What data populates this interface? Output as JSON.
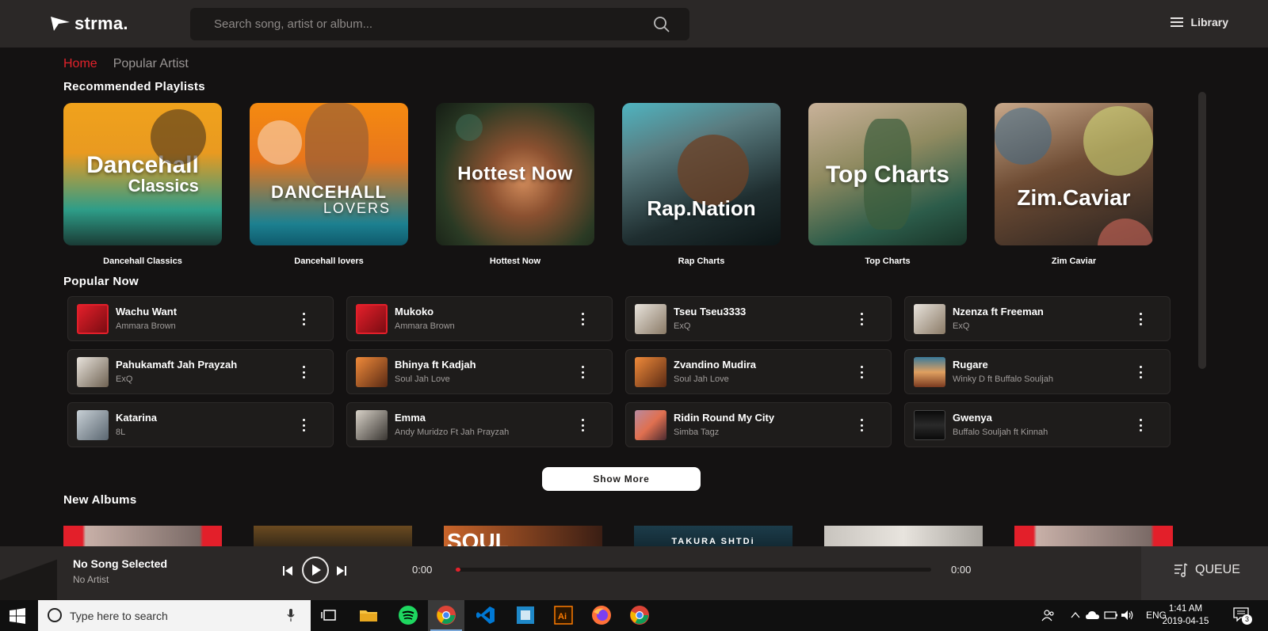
{
  "header": {
    "logo_text": "strma.",
    "search_placeholder": "Search song, artist or album...",
    "library_label": "Library"
  },
  "nav": {
    "tabs": [
      {
        "label": "Home",
        "active": true
      },
      {
        "label": "Popular Artist",
        "active": false
      }
    ]
  },
  "sections": {
    "recommended": "Recommended Playlists",
    "popular": "Popular Now",
    "new_albums": "New Albums"
  },
  "playlists": [
    {
      "cover_line1": "Dancehall",
      "cover_line2": "Classics",
      "label": "Dancehall Classics"
    },
    {
      "cover_line1": "DANCEHALL",
      "cover_line2": "LOVERS",
      "label": "Dancehall lovers"
    },
    {
      "cover_line1": "Hottest Now",
      "cover_line2": "",
      "label": "Hottest Now"
    },
    {
      "cover_line1": "Rap.Nation",
      "cover_line2": "",
      "label": "Rap Charts"
    },
    {
      "cover_line1": "Top Charts",
      "cover_line2": "",
      "label": "Top Charts"
    },
    {
      "cover_line1": "Zim.Caviar",
      "cover_line2": "",
      "label": "Zim Caviar"
    }
  ],
  "popular_songs": [
    {
      "title": "Wachu Want",
      "artist": "Ammara Brown"
    },
    {
      "title": "Mukoko",
      "artist": "Ammara Brown"
    },
    {
      "title": "Tseu Tseu3333",
      "artist": "ExQ"
    },
    {
      "title": "Nzenza ft Freeman",
      "artist": "ExQ"
    },
    {
      "title": "Pahukamaft Jah Prayzah",
      "artist": "ExQ"
    },
    {
      "title": "Bhinya ft Kadjah",
      "artist": "Soul Jah Love"
    },
    {
      "title": "Zvandino Mudira",
      "artist": "Soul Jah Love"
    },
    {
      "title": "Rugare",
      "artist": "Winky D ft Buffalo Souljah"
    },
    {
      "title": "Katarina",
      "artist": "8L"
    },
    {
      "title": "Emma",
      "artist": "Andy Muridzo Ft Jah Prayzah"
    },
    {
      "title": "Ridin Round My City",
      "artist": "Simba Tagz"
    },
    {
      "title": "Gwenya",
      "artist": "Buffalo Souljah ft Kinnah"
    }
  ],
  "show_more_label": "Show More",
  "albums": [
    {
      "cover_text": ""
    },
    {
      "cover_text": ""
    },
    {
      "cover_text": "SOUL"
    },
    {
      "cover_text": "TAKURA SHTDi"
    },
    {
      "cover_text": ""
    },
    {
      "cover_text": ""
    }
  ],
  "player": {
    "song_title": "No Song Selected",
    "artist": "No Artist",
    "elapsed": "0:00",
    "duration": "0:00",
    "progress": 0.01,
    "queue_label": "QUEUE"
  },
  "taskbar": {
    "search_placeholder": "Type here to search",
    "language": "ENG",
    "time": "1:41 AM",
    "date": "2019-04-15",
    "notification_count": "3"
  },
  "colors": {
    "accent": "#e3222b",
    "background": "#141212",
    "header": "#2b2827"
  }
}
